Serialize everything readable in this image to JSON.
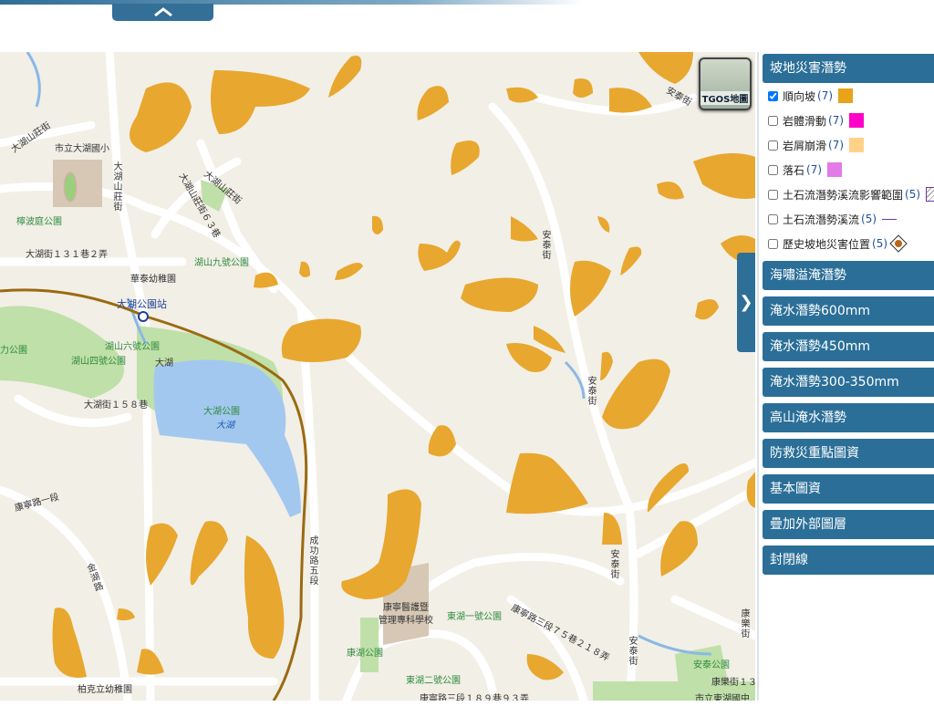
{
  "top_toggle": {
    "icon": "chevron-up-icon"
  },
  "map": {
    "tgos_label": "TGOS地圖",
    "side_toggle_icon": "chevron-right-icon",
    "labels": {
      "school1": "市立大湖國小",
      "park1": "檸波庭公園",
      "street1": "大湖街１３１巷２弄",
      "street2": "大湖山莊街",
      "street3": "大湖山莊街",
      "street4": "大湖山莊街６３巷",
      "park2": "湖山九號公園",
      "kinder": "華泰幼稚園",
      "station": "大湖公園站",
      "park3": "湖山六號公園",
      "park4": "湖山四號公園",
      "park5": "力公園",
      "place1": "大湖",
      "street5": "大湖街１５８巷",
      "lakepark": "大湖公園",
      "lake": "大湖",
      "road1": "康寧路一段",
      "road2": "金湖路",
      "road3": "成功路五段",
      "school2": "康寧醫護暨",
      "school2b": "管理專科學校",
      "park6": "康湖公園",
      "park7": "東湖一號公園",
      "park8": "東湖二號公園",
      "street6": "康寧路三段７５巷２１８弄",
      "street7": "康寧路三段１８９巷９３弄",
      "street8": "安泰街",
      "street9": "安泰街",
      "street10": "安泰街",
      "street11": "安泰街",
      "street12": "安泰街",
      "park9": "安泰公園",
      "street13": "康樂街１３",
      "school3": "市立東湖國中",
      "kinder2": "柏克立幼稚園",
      "street14": "大湖山莊街",
      "street15": "康樂街"
    }
  },
  "panel": {
    "section_title": "坡地災害潛勢",
    "layers": [
      {
        "label": "順向坡",
        "count": "(7)",
        "checked": true,
        "color": "#e8a317"
      },
      {
        "label": "岩體滑動",
        "count": "(7)",
        "checked": false,
        "color": "#ff00c8"
      },
      {
        "label": "岩屑崩滑",
        "count": "(7)",
        "checked": false,
        "color": "#ffd28a"
      },
      {
        "label": "落石",
        "count": "(7)",
        "checked": false,
        "color": "#e27ae8"
      },
      {
        "label": "土石流潛勢溪流影響範圍",
        "count": "(5)",
        "checked": false,
        "color": "hatched"
      },
      {
        "label": "土石流潛勢溪流",
        "count": "(5)",
        "checked": false,
        "color": "#6a3aa0"
      },
      {
        "label": "歷史坡地災害位置",
        "count": "(5)",
        "checked": false,
        "color": "diamond-icon"
      }
    ],
    "sections": [
      "海嘯溢淹潛勢",
      "淹水潛勢600mm",
      "淹水潛勢450mm",
      "淹水潛勢300-350mm",
      "高山淹水潛勢",
      "防救災重點圖資",
      "基本圖資",
      "疊加外部圖層",
      "封閉線"
    ]
  },
  "colors": {
    "accent": "#2b6f98",
    "hazard": "#e8a72f",
    "lake": "#a3c8ef",
    "park": "#bfe0a8",
    "background": "#f2efe6"
  }
}
